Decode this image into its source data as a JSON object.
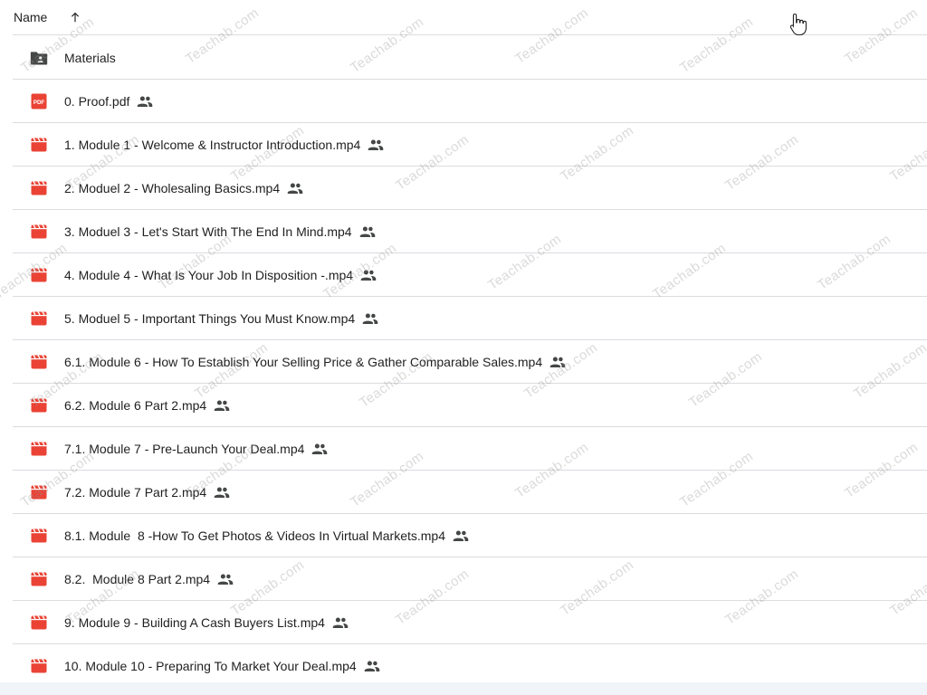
{
  "header": {
    "name_label": "Name",
    "sort_icon": "arrow-upward-icon"
  },
  "colors": {
    "video_icon": "#ea4335",
    "pdf_icon": "#ea4335",
    "folder_icon": "#444746",
    "shared_icon": "#444746",
    "divider": "#dadce0"
  },
  "files": [
    {
      "type": "folder",
      "name": "Materials",
      "shared": false
    },
    {
      "type": "pdf",
      "name": "0. Proof.pdf",
      "shared": true
    },
    {
      "type": "video",
      "name": "1. Module 1 - Welcome & Instructor Introduction.mp4",
      "shared": true
    },
    {
      "type": "video",
      "name": "2. Moduel 2 - Wholesaling Basics.mp4",
      "shared": true
    },
    {
      "type": "video",
      "name": "3. Moduel 3 - Let's Start With The End In Mind.mp4",
      "shared": true
    },
    {
      "type": "video",
      "name": "4. Module 4 - What Is Your Job In Disposition -.mp4",
      "shared": true
    },
    {
      "type": "video",
      "name": "5. Moduel 5 - Important Things You Must Know.mp4",
      "shared": true
    },
    {
      "type": "video",
      "name": "6.1. Module 6 - How To Establish Your Selling Price & Gather Comparable Sales.mp4",
      "shared": true
    },
    {
      "type": "video",
      "name": "6.2. Module 6 Part 2.mp4",
      "shared": true
    },
    {
      "type": "video",
      "name": "7.1. Module 7 - Pre-Launch Your Deal.mp4",
      "shared": true
    },
    {
      "type": "video",
      "name": "7.2. Module 7 Part 2.mp4",
      "shared": true
    },
    {
      "type": "video",
      "name": "8.1. Module  8 -How To Get Photos & Videos In Virtual Markets.mp4",
      "shared": true
    },
    {
      "type": "video",
      "name": "8.2.  Module 8 Part 2.mp4",
      "shared": true
    },
    {
      "type": "video",
      "name": "9. Module 9 - Building A Cash Buyers List.mp4",
      "shared": true
    },
    {
      "type": "video",
      "name": "10. Module 10 - Preparing To Market Your Deal.mp4",
      "shared": true
    }
  ],
  "watermark": {
    "text": "Teachab.com"
  }
}
